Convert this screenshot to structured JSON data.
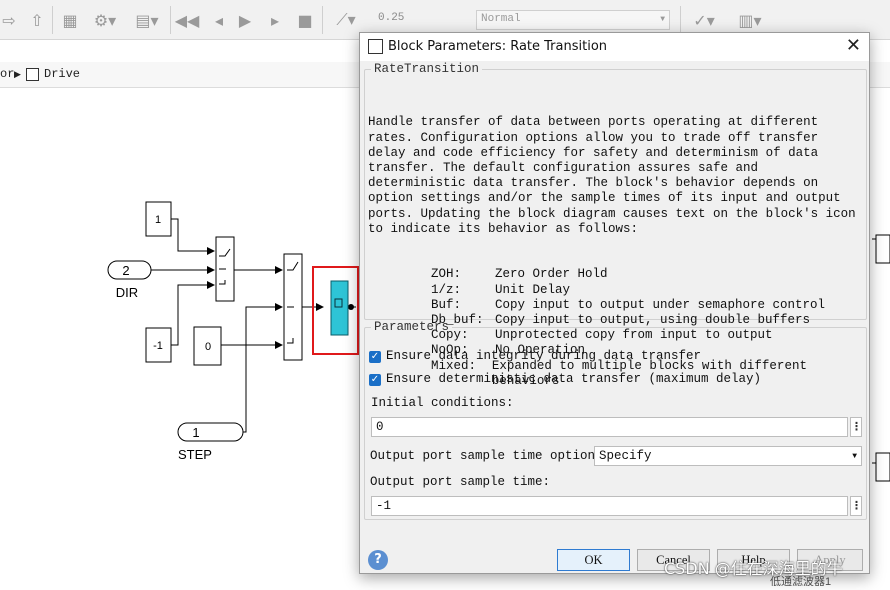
{
  "toolbar": {
    "sim_time": "0.25",
    "sim_mode": "Normal"
  },
  "addressbar": {
    "crumb_prev": "or",
    "crumb_current": "Drive"
  },
  "diagram": {
    "const_1": "1",
    "const_neg1": "-1",
    "const_0": "0",
    "inport_dir_num": "2",
    "inport_dir_name": "DIR",
    "inport_step_num": "1",
    "inport_step_name": "STEP",
    "highlight_color": "#e0191b",
    "block_color": "#2ec4d6"
  },
  "dialog": {
    "title": "Block Parameters: Rate Transition",
    "close_symbol": "✕",
    "section_block": "RateTransition",
    "description": "Handle transfer of data between ports operating at different rates. Configuration options allow you to trade off transfer delay and code efficiency for safety and determinism of data transfer. The default configuration assures safe and deterministic data transfer. The block's behavior depends on option settings and/or the sample times of its input and output ports. Updating the block diagram causes text on the block's icon to indicate its behavior as follows:",
    "legend": [
      {
        "key": "ZOH:",
        "value": "Zero Order Hold"
      },
      {
        "key": "1/z:",
        "value": "Unit Delay"
      },
      {
        "key": "Buf:",
        "value": "Copy input to output under semaphore control"
      },
      {
        "key": "Db_buf:",
        "value": "Copy input to output, using double buffers"
      },
      {
        "key": "Copy:",
        "value": "Unprotected copy from input to output"
      },
      {
        "key": "NoOp:",
        "value": "No Operation"
      },
      {
        "key": "Mixed:",
        "value": "Expanded to multiple blocks with different behaviors"
      }
    ],
    "section_params": "Parameters",
    "check_integrity": "Ensure data integrity during data transfer",
    "check_deterministic": "Ensure deterministic data transfer (maximum delay)",
    "initial_conditions_label": "Initial conditions:",
    "initial_conditions_value": "0",
    "sample_time_options_label": "Output port sample time options:",
    "sample_time_options_value": "Specify",
    "sample_time_label": "Output port sample time:",
    "sample_time_value": "-1",
    "more_symbol": "⋮",
    "btn_ok": "OK",
    "btn_cancel": "Cancel",
    "btn_help": "Help",
    "btn_apply": "Apply",
    "help_icon": "?"
  },
  "watermark": "CSDN @住在深海里的牛",
  "bottom_partial_label": "低通滤波器1"
}
